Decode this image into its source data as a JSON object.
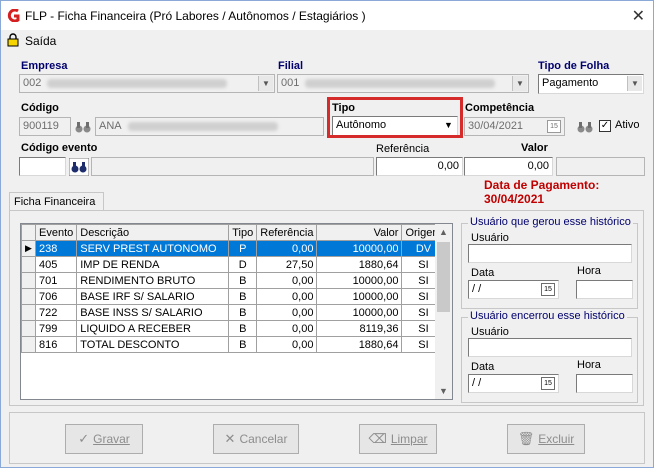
{
  "window": {
    "title": "FLP - Ficha Financeira (Pró Labores / Autônomos / Estagiários )",
    "close_glyph": "✕",
    "accent": "#d52b2b"
  },
  "menu": {
    "saida": "Saída"
  },
  "labels": {
    "empresa": "Empresa",
    "filial": "Filial",
    "tipo_de_folha": "Tipo de Folha",
    "codigo": "Código",
    "tipo": "Tipo",
    "competencia": "Competência",
    "ativo": "Ativo",
    "codigo_evento": "Código evento",
    "referencia": "Referência",
    "valor": "Valor",
    "data_pagamento": "Data de Pagamento: 30/04/2021"
  },
  "fields": {
    "empresa_code": "002",
    "filial_code": "001",
    "tipo_de_folha": "Pagamento",
    "codigo": "900119",
    "nome": "ANA",
    "tipo": "Autônomo",
    "competencia": "30/04/2021",
    "codigo_evento": "",
    "evento_descricao": "",
    "referencia": "0,00",
    "valor": "0,00",
    "extra": ""
  },
  "tabs": [
    {
      "label": "Ficha Financeira"
    }
  ],
  "grid": {
    "columns": [
      "Evento",
      "Descrição",
      "Tipo",
      "Referência",
      "Valor",
      "Origem"
    ],
    "rows": [
      {
        "evento": "238",
        "descricao": "SERV PREST AUTONOMO",
        "tipo": "P",
        "referencia": "0,00",
        "valor": "10000,00",
        "origem": "DV"
      },
      {
        "evento": "405",
        "descricao": "IMP DE RENDA",
        "tipo": "D",
        "referencia": "27,50",
        "valor": "1880,64",
        "origem": "SI"
      },
      {
        "evento": "701",
        "descricao": "RENDIMENTO BRUTO",
        "tipo": "B",
        "referencia": "0,00",
        "valor": "10000,00",
        "origem": "SI"
      },
      {
        "evento": "706",
        "descricao": "BASE IRF S/ SALARIO",
        "tipo": "B",
        "referencia": "0,00",
        "valor": "10000,00",
        "origem": "SI"
      },
      {
        "evento": "722",
        "descricao": "BASE INSS S/ SALARIO",
        "tipo": "B",
        "referencia": "0,00",
        "valor": "10000,00",
        "origem": "SI"
      },
      {
        "evento": "799",
        "descricao": "LIQUIDO A RECEBER",
        "tipo": "B",
        "referencia": "0,00",
        "valor": "8119,36",
        "origem": "SI"
      },
      {
        "evento": "816",
        "descricao": "TOTAL DESCONTO",
        "tipo": "B",
        "referencia": "0,00",
        "valor": "1880,64",
        "origem": "SI"
      }
    ]
  },
  "historico_gerou": {
    "legend": "Usuário que gerou esse histórico",
    "usuario_label": "Usuário",
    "data_label": "Data",
    "hora_label": "Hora",
    "data_value": " / /",
    "usuario_value": "",
    "hora_value": ""
  },
  "historico_encerrou": {
    "legend": "Usuário encerrou esse histórico",
    "usuario_label": "Usuário",
    "data_label": "Data",
    "hora_label": "Hora",
    "data_value": " / /",
    "usuario_value": "",
    "hora_value": ""
  },
  "buttons": {
    "gravar": "Gravar",
    "cancelar": "Cancelar",
    "limpar": "Limpar",
    "excluir": "Excluir"
  },
  "icons": {
    "app": "app-logo-icon",
    "saida": "lock-icon",
    "search": "binoculars-icon",
    "calendar": "calendar-icon",
    "dropdown": "chevron-down-icon"
  }
}
